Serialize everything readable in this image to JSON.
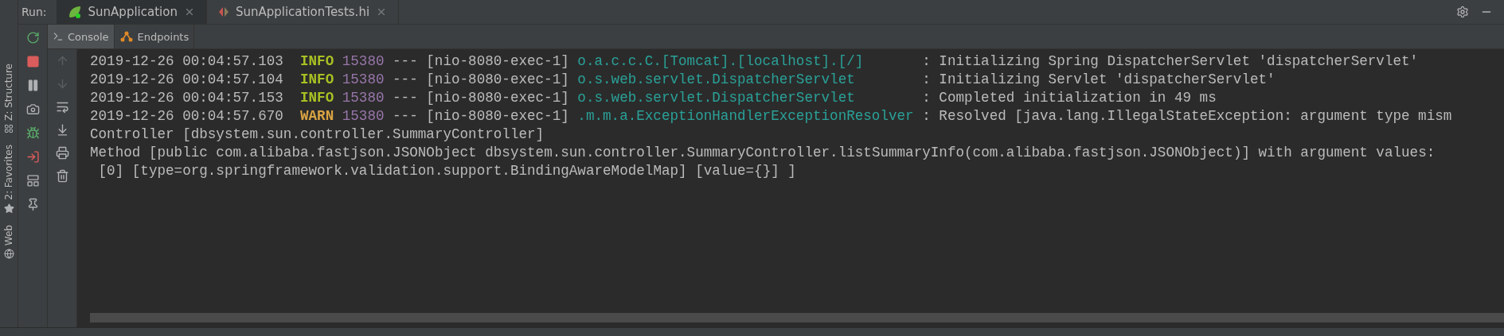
{
  "run_bar": {
    "label": "Run:",
    "tabs": [
      {
        "label": "SunApplication",
        "kind": "spring",
        "selected": true
      },
      {
        "label": "SunApplicationTests.hi",
        "kind": "http",
        "selected": false
      }
    ]
  },
  "side_stripe": [
    {
      "label": "Z: Structure",
      "kind": "structure"
    },
    {
      "label": "2: Favorites",
      "kind": "favorites"
    },
    {
      "label": "Web",
      "kind": "web"
    }
  ],
  "run_tools": [
    {
      "kind": "rerun"
    },
    {
      "kind": "stop"
    },
    {
      "kind": "pause"
    },
    {
      "kind": "snapshot"
    },
    {
      "kind": "debug"
    },
    {
      "kind": "exit"
    },
    {
      "kind": "layout"
    },
    {
      "kind": "pin"
    }
  ],
  "console_tabs": [
    {
      "label": "Console",
      "kind": "console",
      "selected": true
    },
    {
      "label": "Endpoints",
      "kind": "endpoints",
      "selected": false
    }
  ],
  "console_tools": [
    {
      "kind": "up",
      "disabled": true
    },
    {
      "kind": "down",
      "disabled": true
    },
    {
      "kind": "wrap",
      "disabled": false
    },
    {
      "kind": "scroll-end",
      "disabled": false
    },
    {
      "kind": "print",
      "disabled": false
    },
    {
      "kind": "clear",
      "disabled": false
    }
  ],
  "log_lines": [
    {
      "kind": "entry",
      "timestamp": "2019-12-26 00:04:57.103",
      "level": "INFO",
      "color": "#a8c023",
      "pid": "15380",
      "separator": "---",
      "thread": "[nio-8080-exec-1]",
      "logger": "o.a.c.c.C.[Tomcat].[localhost].[/]",
      "message": ": Initializing Spring DispatcherServlet 'dispatcherServlet'"
    },
    {
      "kind": "entry",
      "timestamp": "2019-12-26 00:04:57.104",
      "level": "INFO",
      "color": "#a8c023",
      "pid": "15380",
      "separator": "---",
      "thread": "[nio-8080-exec-1]",
      "logger": "o.s.web.servlet.DispatcherServlet",
      "message": ": Initializing Servlet 'dispatcherServlet'"
    },
    {
      "kind": "entry",
      "timestamp": "2019-12-26 00:04:57.153",
      "level": "INFO",
      "color": "#a8c023",
      "pid": "15380",
      "separator": "---",
      "thread": "[nio-8080-exec-1]",
      "logger": "o.s.web.servlet.DispatcherServlet",
      "message": ": Completed initialization in 49 ms"
    },
    {
      "kind": "entry",
      "timestamp": "2019-12-26 00:04:57.670",
      "level": "WARN",
      "color": "#d9a343",
      "pid": "15380",
      "separator": "---",
      "thread": "[nio-8080-exec-1]",
      "logger": ".m.m.a.ExceptionHandlerExceptionResolver",
      "message": ": Resolved [java.lang.IllegalStateException: argument type mism"
    },
    {
      "kind": "text",
      "text": "Controller [dbsystem.sun.controller.SummaryController]"
    },
    {
      "kind": "text",
      "text": "Method [public com.alibaba.fastjson.JSONObject dbsystem.sun.controller.SummaryController.listSummaryInfo(com.alibaba.fastjson.JSONObject)] with argument values:"
    },
    {
      "kind": "text",
      "text": " [0] [type=org.springframework.validation.support.BindingAwareModelMap] [value={}] ]"
    }
  ]
}
